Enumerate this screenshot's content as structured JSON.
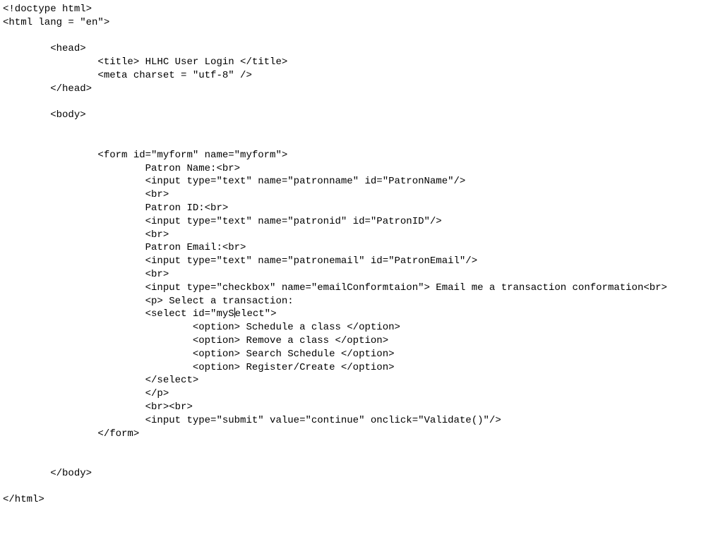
{
  "lines": {
    "l01": "<!doctype html>",
    "l02": "<html lang = \"en\">",
    "l03": "",
    "l04": "        <head>",
    "l05": "                <title> HLHC User Login </title>",
    "l06": "                <meta charset = \"utf-8\" />",
    "l07": "        </head>",
    "l08": "",
    "l09": "        <body>",
    "l10": "",
    "l11": "",
    "l12": "                <form id=\"myform\" name=\"myform\">",
    "l13": "                        Patron Name:<br>",
    "l14": "                        <input type=\"text\" name=\"patronname\" id=\"PatronName\"/>",
    "l15": "                        <br>",
    "l16": "                        Patron ID:<br>",
    "l17": "                        <input type=\"text\" name=\"patronid\" id=\"PatronID\"/>",
    "l18": "                        <br>",
    "l19": "                        Patron Email:<br>",
    "l20": "                        <input type=\"text\" name=\"patronemail\" id=\"PatronEmail\"/>",
    "l21": "                        <br>",
    "l22": "                        <input type=\"checkbox\" name=\"emailConformtaion\"> Email me a transaction conformation<br>",
    "l23": "                        <p> Select a transaction:",
    "l24a": "                        <select id=\"myS",
    "l24b": "elect\">",
    "l25": "                                <option> Schedule a class </option>",
    "l26": "                                <option> Remove a class </option>",
    "l27": "                                <option> Search Schedule </option>",
    "l28": "                                <option> Register/Create </option>",
    "l29": "                        </select>",
    "l30": "                        </p>",
    "l31": "                        <br><br>",
    "l32": "                        <input type=\"submit\" value=\"continue\" onclick=\"Validate()\"/>",
    "l33": "                </form>",
    "l34": "",
    "l35": "",
    "l36": "        </body>",
    "l37": "",
    "l38": "</html>"
  }
}
